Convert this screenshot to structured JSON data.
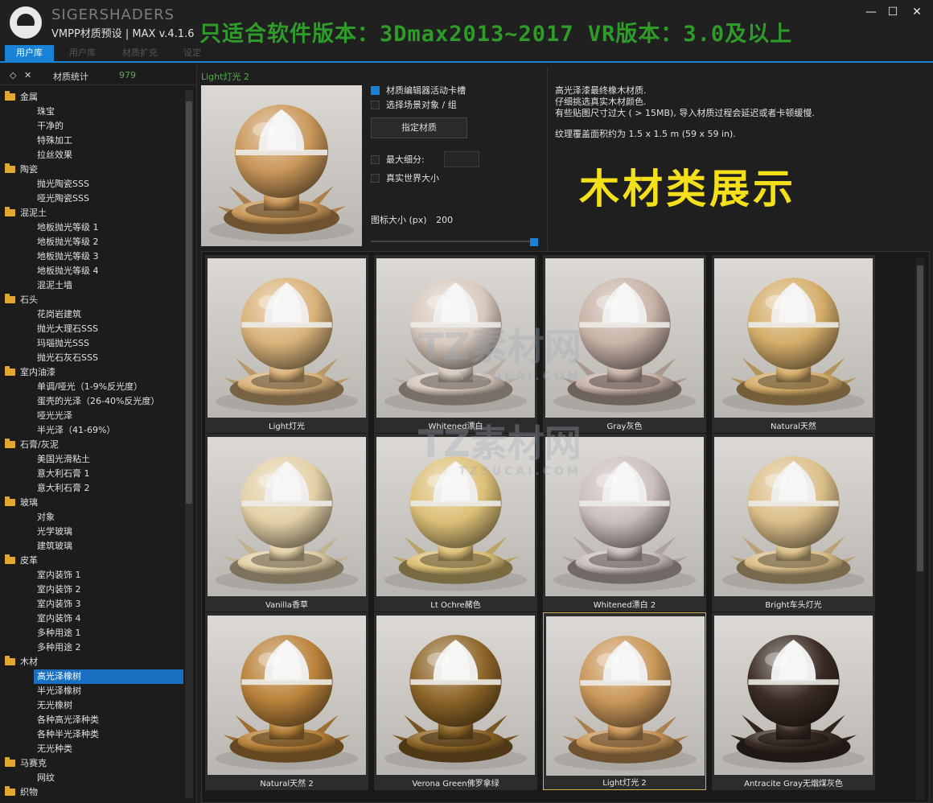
{
  "window": {
    "brand": "SIGERSHADERS",
    "subtitle": "VMPP材质预设 | MAX v.4.1.6",
    "banner": "只适合软件版本：3Dmax2013~2017  VR版本：3.0及以上",
    "minimize": "—",
    "maximize": "☐",
    "close": "✕"
  },
  "tabs": [
    "用户库",
    "用户库",
    "材质扩充",
    "设定"
  ],
  "left_panel": {
    "header_icon1": "◇",
    "header_icon2": "✕",
    "header_label": "材质统计",
    "header_count": "979",
    "tree": [
      {
        "label": "金属",
        "type": "cat"
      },
      {
        "label": "珠宝",
        "type": "sub"
      },
      {
        "label": "干净的",
        "type": "sub"
      },
      {
        "label": "特殊加工",
        "type": "sub"
      },
      {
        "label": "拉丝效果",
        "type": "sub"
      },
      {
        "label": "陶瓷",
        "type": "cat"
      },
      {
        "label": "抛光陶瓷SSS",
        "type": "sub"
      },
      {
        "label": "哑光陶瓷SSS",
        "type": "sub"
      },
      {
        "label": "混泥土",
        "type": "cat"
      },
      {
        "label": "地板抛光等级 1",
        "type": "sub"
      },
      {
        "label": "地板抛光等级 2",
        "type": "sub"
      },
      {
        "label": "地板抛光等级 3",
        "type": "sub"
      },
      {
        "label": "地板抛光等级 4",
        "type": "sub"
      },
      {
        "label": "混泥土墙",
        "type": "sub"
      },
      {
        "label": "石头",
        "type": "cat"
      },
      {
        "label": "花岗岩建筑",
        "type": "sub"
      },
      {
        "label": "抛光大理石SSS",
        "type": "sub"
      },
      {
        "label": "玛瑙抛光SSS",
        "type": "sub"
      },
      {
        "label": "抛光石灰石SSS",
        "type": "sub"
      },
      {
        "label": "室内油漆",
        "type": "cat"
      },
      {
        "label": "单调/哑光（1-9%反光度）",
        "type": "sub"
      },
      {
        "label": "蛋壳的光泽（26-40%反光度）",
        "type": "sub"
      },
      {
        "label": "哑光光泽",
        "type": "sub"
      },
      {
        "label": "半光泽（41-69%）",
        "type": "sub"
      },
      {
        "label": "石膏/灰泥",
        "type": "cat"
      },
      {
        "label": "美国光滑粘土",
        "type": "sub"
      },
      {
        "label": "意大利石膏 1",
        "type": "sub"
      },
      {
        "label": "意大利石膏 2",
        "type": "sub"
      },
      {
        "label": "玻璃",
        "type": "cat"
      },
      {
        "label": "对象",
        "type": "sub"
      },
      {
        "label": "光学玻璃",
        "type": "sub"
      },
      {
        "label": "建筑玻璃",
        "type": "sub"
      },
      {
        "label": "皮革",
        "type": "cat"
      },
      {
        "label": "室内装饰 1",
        "type": "sub"
      },
      {
        "label": "室内装饰 2",
        "type": "sub"
      },
      {
        "label": "室内装饰 3",
        "type": "sub"
      },
      {
        "label": "室内装饰 4",
        "type": "sub"
      },
      {
        "label": "多种用途 1",
        "type": "sub"
      },
      {
        "label": "多种用途 2",
        "type": "sub"
      },
      {
        "label": "木材",
        "type": "cat"
      },
      {
        "label": "高光泽橡树",
        "type": "sub",
        "selected": true
      },
      {
        "label": "半光泽橡树",
        "type": "sub"
      },
      {
        "label": "无光橡树",
        "type": "sub"
      },
      {
        "label": "各种高光泽种类",
        "type": "sub"
      },
      {
        "label": "各种半光泽种类",
        "type": "sub"
      },
      {
        "label": "无光种类",
        "type": "sub"
      },
      {
        "label": "马赛克",
        "type": "cat"
      },
      {
        "label": "网纹",
        "type": "sub"
      },
      {
        "label": "织物",
        "type": "cat"
      }
    ]
  },
  "preview": {
    "title": "Light灯光 2"
  },
  "options": {
    "editor_slot": "材质编辑器活动卡槽",
    "select_scene": "选择场景对象 / 组",
    "assign_button": "指定材质",
    "max_subdiv": "最大细分:",
    "real_world": "真实世界大小",
    "icon_size_label": "图标大小 (px)",
    "icon_size_value": "200"
  },
  "description": {
    "line1": "高光泽漆最终橡木材质.",
    "line2": "仔细挑选真实木材颜色.",
    "line3": "有些贴图尺寸过大 ( > 15MB), 导入材质过程会延迟或者卡顿缓慢.",
    "line4": "纹理覆盖面积约为 1.5 x 1.5 m (59 x 59 in).",
    "showcase": "木材类展示"
  },
  "materials": [
    {
      "name": "Light灯光",
      "color": "#d9b27a"
    },
    {
      "name": "Whitened漂白",
      "color": "#d8c9bd"
    },
    {
      "name": "Gray灰色",
      "color": "#c8b3a7"
    },
    {
      "name": "Natural天然",
      "color": "#d4ad6a"
    },
    {
      "name": "Vanilla香草",
      "color": "#e3d0a6"
    },
    {
      "name": "Lt Ochre赭色",
      "color": "#dcc078"
    },
    {
      "name": "Whitened漂白 2",
      "color": "#cbbfbd"
    },
    {
      "name": "Bright车头灯光",
      "color": "#dcbf8a"
    },
    {
      "name": "Natural天然 2",
      "color": "#b9823a"
    },
    {
      "name": "Verona Green佛罗拿绿",
      "color": "#8d6528"
    },
    {
      "name": "Light灯光 2",
      "color": "#c99759",
      "active": true
    },
    {
      "name": "Antracite Gray无烟煤灰色",
      "color": "#3a2b24"
    }
  ],
  "watermark": {
    "main": "TZ素材网",
    "url": "TZSUCAI.COM",
    "side": "TZ素材网"
  }
}
